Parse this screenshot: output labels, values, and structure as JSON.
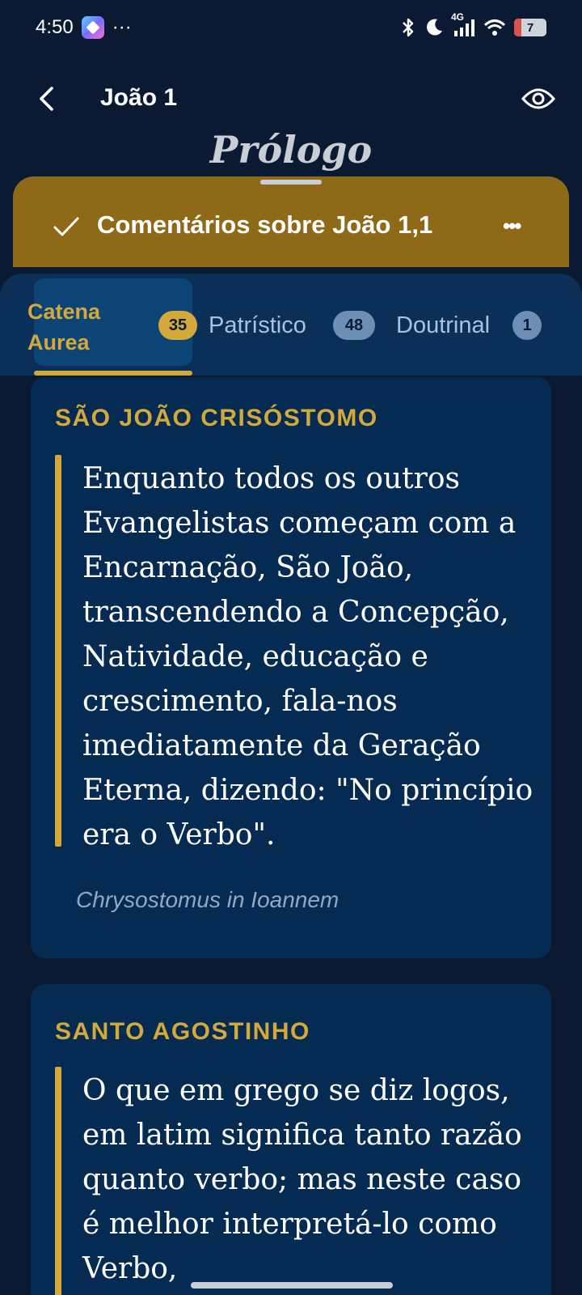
{
  "status_bar": {
    "time": "4:50",
    "more": "···",
    "network": "4G",
    "battery": "7",
    "icons": [
      "app-icon",
      "bluetooth-icon",
      "moon-icon",
      "signal-icon",
      "wifi-icon",
      "battery-icon"
    ]
  },
  "app_bar": {
    "title": "João 1",
    "back_icon": "chevron-left-icon",
    "visibility_icon": "eye-icon"
  },
  "section": {
    "title": "Prólogo"
  },
  "sheet": {
    "title": "Comentários sobre João 1,1",
    "more": "•••",
    "check_icon": "check-icon",
    "color": "#8e6a18"
  },
  "tabs": {
    "items": [
      {
        "label": "Catena Aurea",
        "count": "35",
        "selected": true
      },
      {
        "label": "Patrístico",
        "count": "48",
        "selected": false
      },
      {
        "label": "Doutrinal",
        "count": "1",
        "selected": false
      }
    ],
    "accent": "#d4a93b"
  },
  "comments": [
    {
      "author": "SÃO JOÃO CRISÓSTOMO",
      "text": "Enquanto todos os outros Evangelistas começam com a Encarnação, São João, transcendendo a Concepção, Natividade, educação e crescimento, fala-nos imediatamente da Geração Eterna, dizendo: \"No princípio era o Verbo\".",
      "source": "Chrysostomus in Ioannem"
    },
    {
      "author": "SANTO AGOSTINHO",
      "text": "O que em grego se diz logos, em latim significa tanto razão quanto verbo; mas neste caso é melhor interpretá-lo como Verbo,"
    }
  ]
}
